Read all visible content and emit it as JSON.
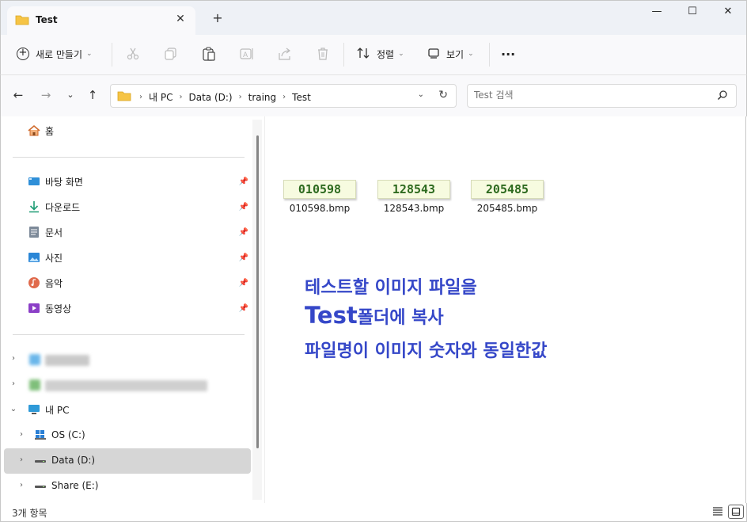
{
  "window": {
    "tab_title": "Test",
    "new_tab": "+",
    "minimize": "—",
    "maximize": "☐",
    "close": "✕"
  },
  "commandbar": {
    "new_label": "새로 만들기",
    "sort_label": "정렬",
    "view_label": "보기",
    "more_label": "···"
  },
  "address": {
    "crumbs": [
      "내 PC",
      "Data (D:)",
      "traing",
      "Test"
    ],
    "search_placeholder": "Test 검색"
  },
  "sidebar": {
    "home": "홈",
    "quick": [
      {
        "label": "바탕 화면",
        "icon": "desktop-icon"
      },
      {
        "label": "다운로드",
        "icon": "download-icon"
      },
      {
        "label": "문서",
        "icon": "document-icon"
      },
      {
        "label": "사진",
        "icon": "pictures-icon"
      },
      {
        "label": "음악",
        "icon": "music-icon"
      },
      {
        "label": "동영상",
        "icon": "videos-icon"
      }
    ],
    "this_pc": "내 PC",
    "drives": [
      {
        "label": "OS (C:)"
      },
      {
        "label": "Data (D:)"
      },
      {
        "label": "Share (E:)"
      }
    ]
  },
  "files": [
    {
      "name": "010598.bmp",
      "digits": "010598"
    },
    {
      "name": "128543.bmp",
      "digits": "128543"
    },
    {
      "name": "205485.bmp",
      "digits": "205485"
    }
  ],
  "note": {
    "line1": "테스트할 이미지 파일을",
    "line2_bold": "Test",
    "line2_rest": "폴더에 복사",
    "line3": "파일명이 이미지 숫자와 동일한값"
  },
  "status": {
    "count": "3개 항목"
  },
  "colors": {
    "accent_note": "#3547c8",
    "selected_row": "#d6d6d6",
    "thumb_digits": "#2d6a1f"
  }
}
